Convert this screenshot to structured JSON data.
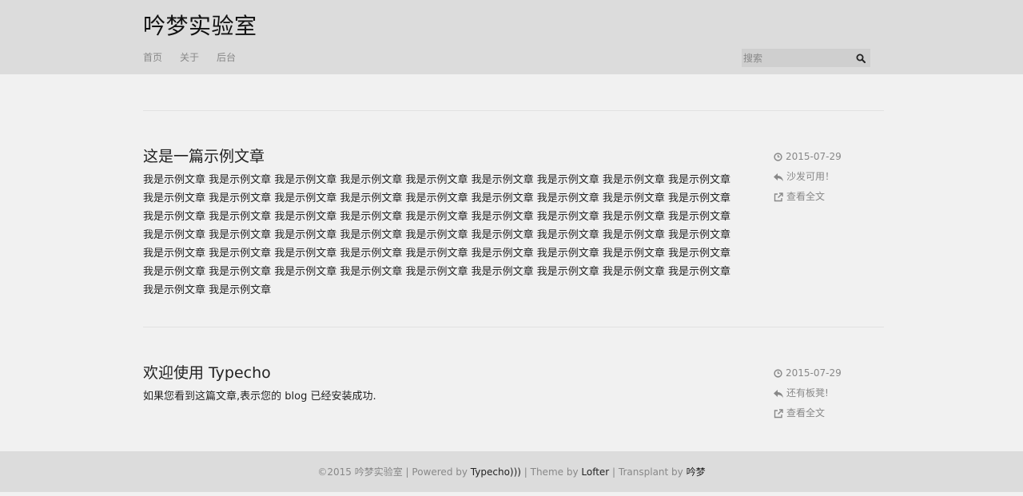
{
  "site": {
    "title": "吟梦实验室"
  },
  "nav": {
    "items": [
      {
        "label": "首页"
      },
      {
        "label": "关于"
      },
      {
        "label": "后台"
      }
    ]
  },
  "search": {
    "placeholder": "搜索",
    "icon": "search-icon"
  },
  "posts": [
    {
      "title": "这是一篇示例文章",
      "body": "我是示例文章 我是示例文章 我是示例文章 我是示例文章 我是示例文章 我是示例文章 我是示例文章 我是示例文章 我是示例文章 我是示例文章 我是示例文章 我是示例文章 我是示例文章 我是示例文章 我是示例文章 我是示例文章 我是示例文章 我是示例文章 我是示例文章 我是示例文章 我是示例文章 我是示例文章 我是示例文章 我是示例文章 我是示例文章 我是示例文章 我是示例文章 我是示例文章 我是示例文章 我是示例文章 我是示例文章 我是示例文章 我是示例文章 我是示例文章 我是示例文章 我是示例文章 我是示例文章 我是示例文章 我是示例文章 我是示例文章 我是示例文章 我是示例文章 我是示例文章 我是示例文章 我是示例文章 我是示例文章 我是示例文章 我是示例文章 我是示例文章 我是示例文章 我是示例文章 我是示例文章 我是示例文章 我是示例文章 我是示例文章 我是示例文章",
      "date": "2015-07-29",
      "comments": "沙发可用！",
      "read_more": "查看全文"
    },
    {
      "title": "欢迎使用 Typecho",
      "body": "如果您看到这篇文章,表示您的 blog 已经安装成功.",
      "date": "2015-07-29",
      "comments": "还有板凳!",
      "read_more": "查看全文"
    }
  ],
  "footer": {
    "copyright": "©2015 吟梦实验室 | Powered by ",
    "typecho_link": "Typecho)))",
    "theme_sep": " | Theme by ",
    "lofter_link": "Lofter",
    "transplant_sep": " | Transplant by ",
    "author_link": "吟梦"
  },
  "colors": {
    "header_bg": "#dcdcdc",
    "page_bg": "#f1f1f1",
    "meta_text": "#888888"
  }
}
